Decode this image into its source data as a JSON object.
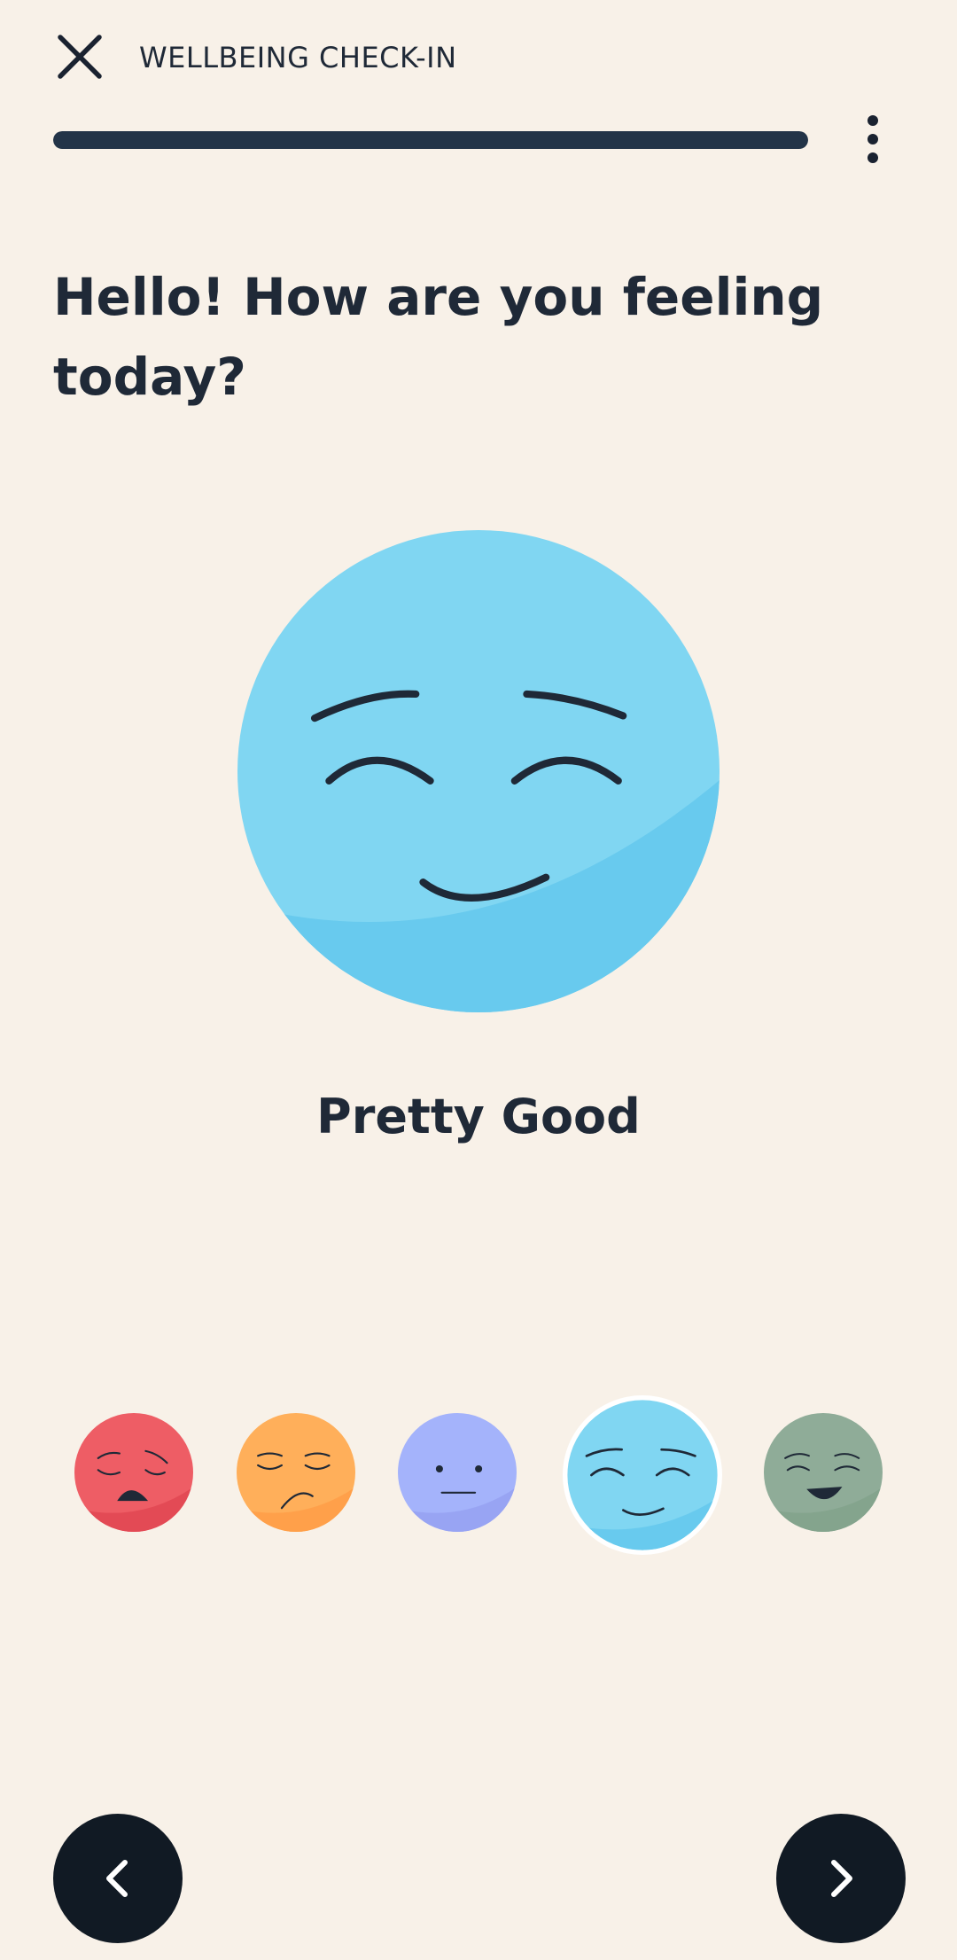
{
  "header": {
    "title": "WELLBEING CHECK-IN",
    "close_icon": "close-icon",
    "more_icon": "more-vertical-icon"
  },
  "progress": {
    "fraction": 1.0,
    "color": "#233448"
  },
  "question": "Hello! How are you feeling today?",
  "selected_mood": {
    "label": "Pretty Good",
    "color": "#80d6f2"
  },
  "mood_options": [
    {
      "name": "very-bad-mood-icon",
      "color": "#ee5d65"
    },
    {
      "name": "bad-mood-icon",
      "color": "#ffaf5a"
    },
    {
      "name": "neutral-mood-icon",
      "color": "#a4b3fb"
    },
    {
      "name": "pretty-good-mood-icon",
      "color": "#80d6f2",
      "selected": true
    },
    {
      "name": "great-mood-icon",
      "color": "#8fac98"
    }
  ],
  "navigation": {
    "back_icon": "chevron-left-icon",
    "next_icon": "chevron-right-icon"
  }
}
